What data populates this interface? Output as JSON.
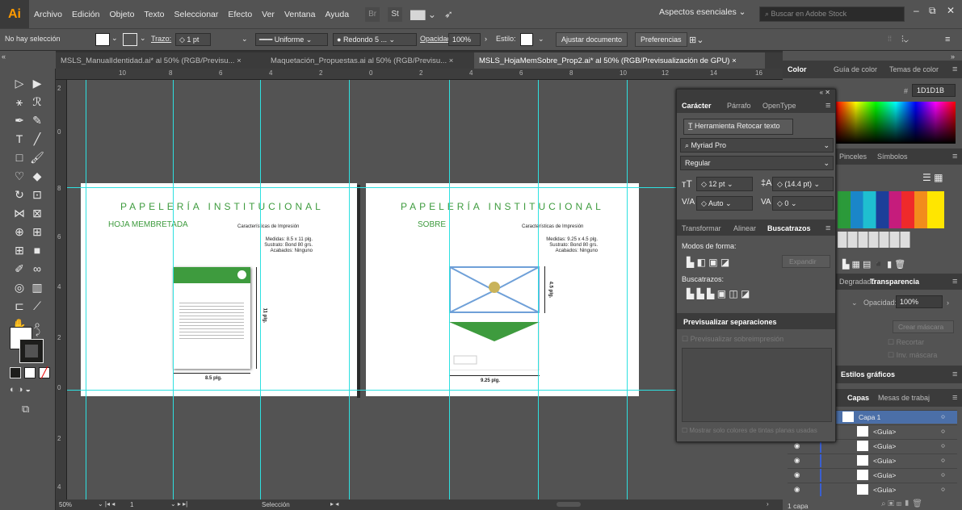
{
  "app": {
    "logo": "Ai",
    "workspace": "Aspectos esenciales ⌄",
    "stock_placeholder": "Buscar en Adobe Stock"
  },
  "menus": [
    "Archivo",
    "Edición",
    "Objeto",
    "Texto",
    "Seleccionar",
    "Efecto",
    "Ver",
    "Ventana",
    "Ayuda"
  ],
  "menubar_icons": {
    "bridge": "Br",
    "stock": "St",
    "arrange": "arrange-docs-icon",
    "gpu": "rocket-icon"
  },
  "control": {
    "selection": "No hay selección",
    "stroke_label": "Trazo:",
    "stroke_value": "1 pt",
    "profile": "Uniforme",
    "brush": "Redondo 5 ...",
    "opacity_label": "Opacidad:",
    "opacity_value": "100%",
    "style_label": "Estilo:",
    "adjust_doc": "Ajustar documento",
    "prefs": "Preferencias"
  },
  "tabs": [
    "MSLS_ManualIdentidad.ai* al 50% (RGB/Previsu...  ×",
    "Maquetación_Propuestas.ai al 50% (RGB/Previsu...  ×",
    "MSLS_HojaMemSobre_Prop2.ai* al 50% (RGB/Previsualización de GPU)  ×"
  ],
  "ruler_top": [
    "10",
    "8",
    "6",
    "4",
    "2",
    "0",
    "2",
    "4",
    "6",
    "8",
    "10",
    "12",
    "14",
    "16"
  ],
  "ruler_left": [
    "2",
    "0",
    "8",
    "6",
    "4",
    "2",
    "0",
    "2",
    "4"
  ],
  "artboard1": {
    "title": "PAPELERÍA  INSTITUCIONAL",
    "subtitle": "HOJA MEMBRETADA",
    "spec_title": "Características de Impresión",
    "spec1": "Medidas: 8.5 x 11 plg.",
    "spec2": "Sustrato: Bond 80 grs.",
    "spec3": "Acabados: Ninguno",
    "dim_w": "8.5 plg.",
    "dim_h": "11 plg."
  },
  "artboard2": {
    "title": "PAPELERÍA  INSTITUCIONAL",
    "subtitle": "SOBRE",
    "spec_title": "Características de Impresión",
    "spec1": "Medidas: 9.25 x 4.5 plg.",
    "spec2": "Sustrato: Bond 80 grs.",
    "spec3": "Acabados: Ninguno",
    "dim_w": "9.25 plg.",
    "dim_h": "4.5 plg."
  },
  "colors": {
    "brand_green": "#3e9b3e",
    "guide": "#2ee0e0",
    "hex": "1D1D1B"
  },
  "color_panel": {
    "tabs": [
      "Color",
      "Guía de color",
      "Temas de color"
    ],
    "hex_prefix": "#",
    "hex": "1D1D1B"
  },
  "swatch_panel": {
    "tabs": [
      "Pinceles",
      "Símbolos"
    ]
  },
  "character": {
    "tabs": [
      "Carácter",
      "Párrafo",
      "OpenType"
    ],
    "retouch": "Herramienta Retocar texto",
    "font": "Myriad Pro",
    "style": "Regular",
    "size": "12 pt",
    "leading": "(14.4 pt)",
    "tracking_mode": "Auto",
    "tracking": "0"
  },
  "pathfinder": {
    "tabs": [
      "Transformar",
      "Alinear",
      "Buscatrazos"
    ],
    "shape_modes": "Modos de forma:",
    "expand": "Expandir",
    "pathfinders": "Buscatrazos:"
  },
  "separations": {
    "title": "Previsualizar separaciones",
    "overprint": "Previsualizar sobreimpresión",
    "spot_only": "Mostrar solo colores de tintas planas usadas"
  },
  "transparency": {
    "tabs": [
      "Degradado",
      "Transparencia"
    ],
    "opacity_label": "Opacidad:",
    "opacity": "100%",
    "make_mask": "Crear máscara",
    "clip": "Recortar",
    "invert": "Inv. máscara"
  },
  "graphic_styles": {
    "title": "Estilos gráficos"
  },
  "layers": {
    "tabs": [
      "Capas",
      "Mesas de trabaj"
    ],
    "items": [
      "Capa 1",
      "<Guía>",
      "<Guía>",
      "<Guía>",
      "<Guía>",
      "<Guía>"
    ],
    "count": "1 capa"
  },
  "status": {
    "zoom": "50%",
    "page": "1",
    "mode": "Selección"
  }
}
